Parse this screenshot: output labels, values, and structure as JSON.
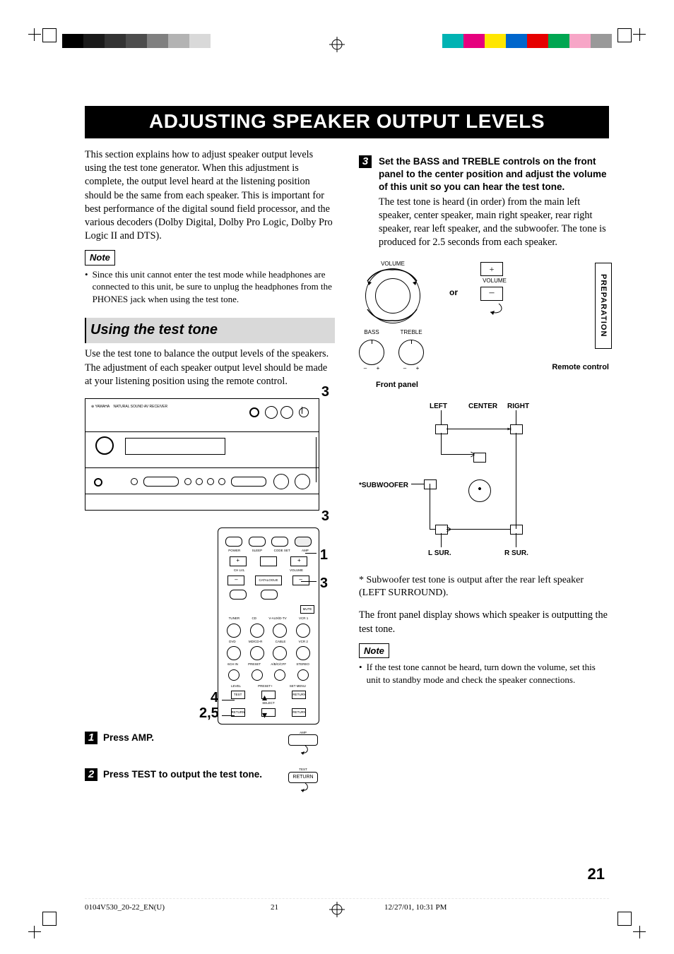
{
  "title": "ADJUSTING SPEAKER OUTPUT LEVELS",
  "intro": "This section explains how to adjust speaker output levels using the test tone generator. When this adjustment is complete, the output level heard at the listening position should be the same from each speaker. This is important for best performance of the digital sound field processor, and the various decoders (Dolby Digital, Dolby Pro Logic, Dolby Pro Logic II and DTS).",
  "note_label": "Note",
  "note1_bullet": "Since this unit cannot enter the test mode while headphones are connected to this unit, be sure to unplug the headphones from the PHONES jack when using the test tone.",
  "subheading": "Using the test tone",
  "sub_intro": "Use the test tone to balance the output levels of the speakers. The adjustment of each speaker output level should be made at your listening position using the remote control.",
  "fp_callout_top": "3",
  "fp_callout_bottom": "3",
  "remote_callouts": {
    "r1": "1",
    "r3": "3",
    "r4": "4",
    "r25": "2,5"
  },
  "remote_labels": {
    "power": "POWER",
    "sleep": "SLEEP",
    "code": "CODE SET",
    "amp": "AMP",
    "volume": "VOLUME",
    "chlvl": "CH LVL",
    "catalogue": "CATALOGUE",
    "plus": "+",
    "minus": "–",
    "mute": "MUTE",
    "row_a": [
      "TUNER",
      "CD",
      "V-AUX/D-TV",
      "VCR 1"
    ],
    "row_b": [
      "DVD",
      "MD/CD-R",
      "CABLE",
      "VCR 2"
    ],
    "mode_a": [
      "6CH IN",
      "PRESET",
      "A/B/C/CFF",
      "STEREO"
    ],
    "btm": [
      "LEVEL",
      "PRESET+",
      "SET MENU"
    ],
    "test": "TEST",
    "return": "RETURN",
    "select": "SELECT"
  },
  "step1_text": "Press AMP.",
  "step1_btn": "AMP",
  "step2_text": "Press TEST to output the test tone.",
  "step2_btn_top": "TEST",
  "step2_btn": "RETURN",
  "step3_text": "Set the BASS and TREBLE controls on the front panel to the center position and adjust the volume of this unit so you can hear the test tone.",
  "step3_body": "The test tone is heard (in order) from the main left speaker, center speaker, main right speaker, rear right speaker, rear left speaker, and the subwoofer. The tone is produced for 2.5 seconds from each speaker.",
  "controls": {
    "volume": "VOLUME",
    "bass": "BASS",
    "treble": "TREBLE",
    "or": "or",
    "plus": "+",
    "minus": "–",
    "front_panel": "Front panel",
    "remote_control": "Remote control"
  },
  "speaker": {
    "left": "LEFT",
    "right": "RIGHT",
    "center": "CENTER",
    "sub": "*SUBWOOFER",
    "lsur": "L SUR.",
    "rsur": "R SUR."
  },
  "sub_foot": "* Subwoofer test tone is output after the rear left speaker (LEFT SURROUND).",
  "panel_shows": "The front panel display shows which speaker is outputting the test tone.",
  "note2_bullet": "If the test tone cannot be heard, turn down the volume, set this unit to standby mode and check the speaker connections.",
  "side_tab": "PREPARATION",
  "page_number": "21",
  "footer": {
    "file": "0104V530_20-22_EN(U)",
    "page": "21",
    "date": "12/27/01, 10:31 PM"
  }
}
